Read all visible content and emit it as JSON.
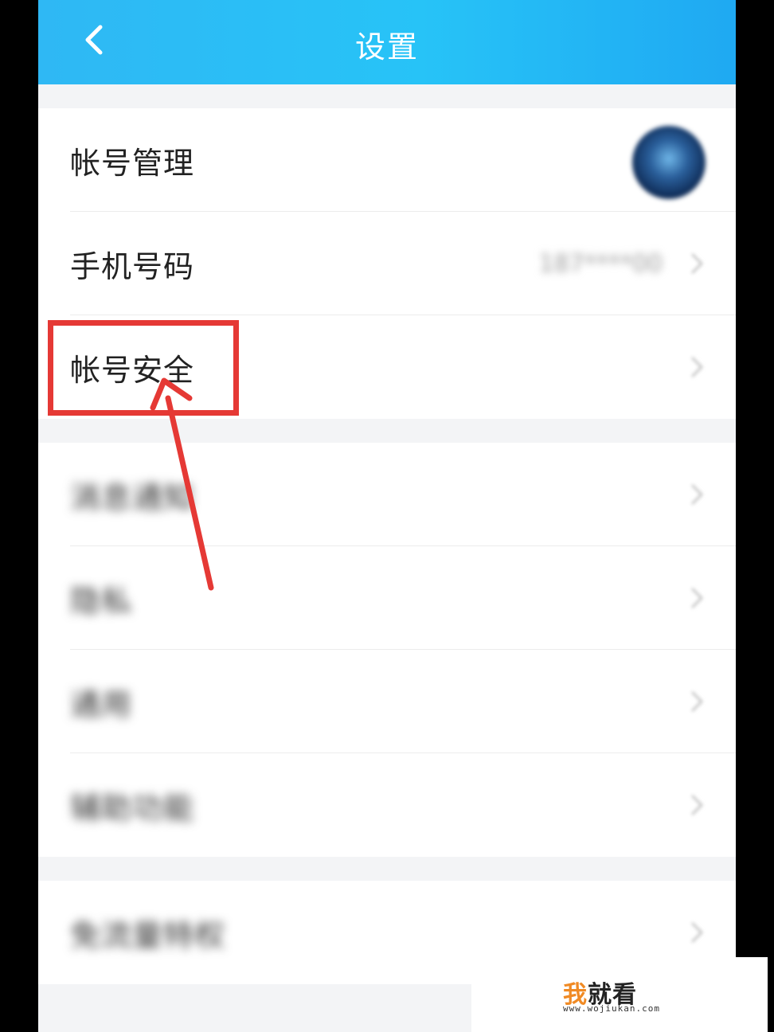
{
  "header": {
    "title": "设置",
    "background_color": "#27c3f7"
  },
  "settings": {
    "group1": [
      {
        "label": "帐号管理",
        "trailing": "avatar"
      },
      {
        "label": "手机号码",
        "trailing": "value",
        "value": "187****00"
      },
      {
        "label": "帐号安全",
        "trailing": "chevron"
      }
    ],
    "group2": [
      {
        "label": "消息通知",
        "trailing": "chevron"
      },
      {
        "label": "隐私",
        "trailing": "chevron"
      },
      {
        "label": "通用",
        "trailing": "chevron"
      },
      {
        "label": "辅助功能",
        "trailing": "chevron"
      }
    ],
    "group3": [
      {
        "label": "免流量特权",
        "trailing": "chevron"
      }
    ]
  },
  "annotation": {
    "highlight_color": "#e53935"
  },
  "watermark": {
    "brand_first": "我",
    "brand_rest": "就看",
    "url": "www.wojiukan.com",
    "brand_first_color": "#f08a24"
  }
}
